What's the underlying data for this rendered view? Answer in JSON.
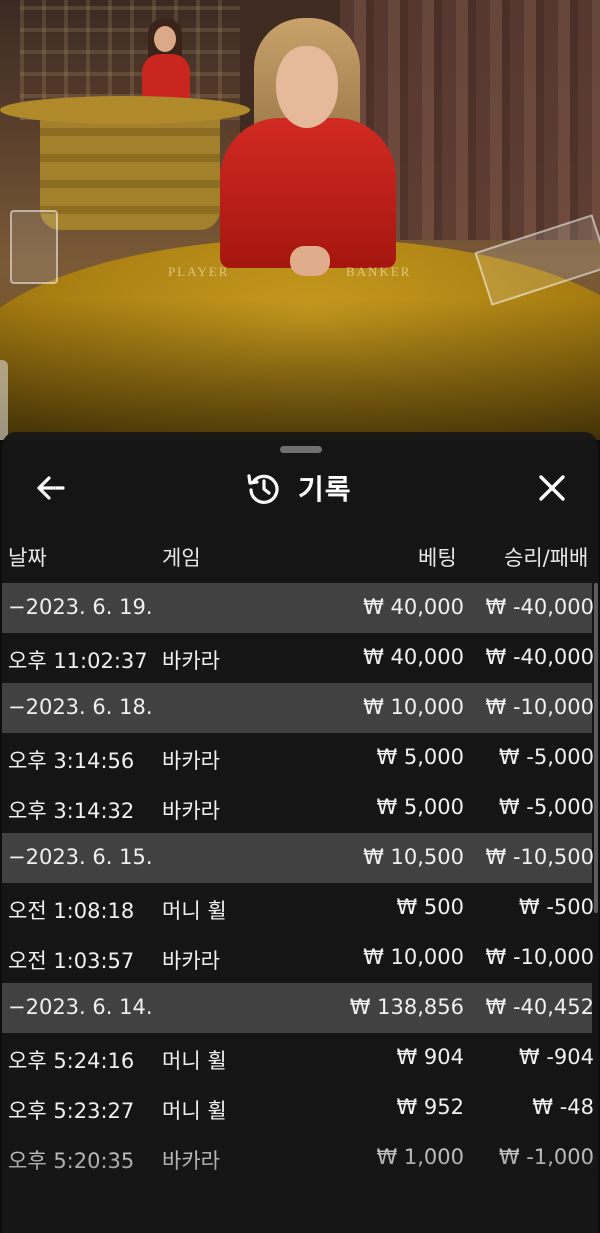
{
  "scene": {
    "table_labels": {
      "player": "PLAYER",
      "banker": "BANKER"
    }
  },
  "header": {
    "title": "기록",
    "back_icon": "arrow-left-icon",
    "history_icon": "history-clock-icon",
    "close_icon": "close-icon"
  },
  "columns": {
    "date": "날짜",
    "game": "게임",
    "bet": "베팅",
    "result": "승리/패배"
  },
  "rows": [
    {
      "type": "date",
      "time": "−2023. 6. 19.",
      "game": "",
      "bet": "₩ 40,000",
      "result": "₩ -40,000"
    },
    {
      "type": "entry",
      "time": "오후 11:02:37",
      "game": "바카라",
      "bet": "₩ 40,000",
      "result": "₩ -40,000"
    },
    {
      "type": "date",
      "time": "−2023. 6. 18.",
      "game": "",
      "bet": "₩ 10,000",
      "result": "₩ -10,000"
    },
    {
      "type": "entry",
      "time": "오후 3:14:56",
      "game": "바카라",
      "bet": "₩ 5,000",
      "result": "₩ -5,000"
    },
    {
      "type": "entry",
      "time": "오후 3:14:32",
      "game": "바카라",
      "bet": "₩ 5,000",
      "result": "₩ -5,000"
    },
    {
      "type": "date",
      "time": "−2023. 6. 15.",
      "game": "",
      "bet": "₩ 10,500",
      "result": "₩ -10,500"
    },
    {
      "type": "entry",
      "time": "오전 1:08:18",
      "game": "머니 휠",
      "bet": "₩ 500",
      "result": "₩ -500"
    },
    {
      "type": "entry",
      "time": "오전 1:03:57",
      "game": "바카라",
      "bet": "₩ 10,000",
      "result": "₩ -10,000"
    },
    {
      "type": "date",
      "time": "−2023. 6. 14.",
      "game": "",
      "bet": "₩ 138,856",
      "result": "₩ -40,452"
    },
    {
      "type": "entry",
      "time": "오후 5:24:16",
      "game": "머니 휠",
      "bet": "₩ 904",
      "result": "₩ -904"
    },
    {
      "type": "entry",
      "time": "오후 5:23:27",
      "game": "머니 휠",
      "bet": "₩ 952",
      "result": "₩ -48"
    },
    {
      "type": "entry",
      "time": "오후 5:20:35",
      "game": "바카라",
      "bet": "₩ 1,000",
      "result": "₩ -1,000"
    }
  ],
  "colors": {
    "sheet_bg": "#161616",
    "date_row_bg": "#505050",
    "text": "#f0f0f0",
    "table_gold": "#c69a1e",
    "dealer_dress": "#d12a22"
  }
}
